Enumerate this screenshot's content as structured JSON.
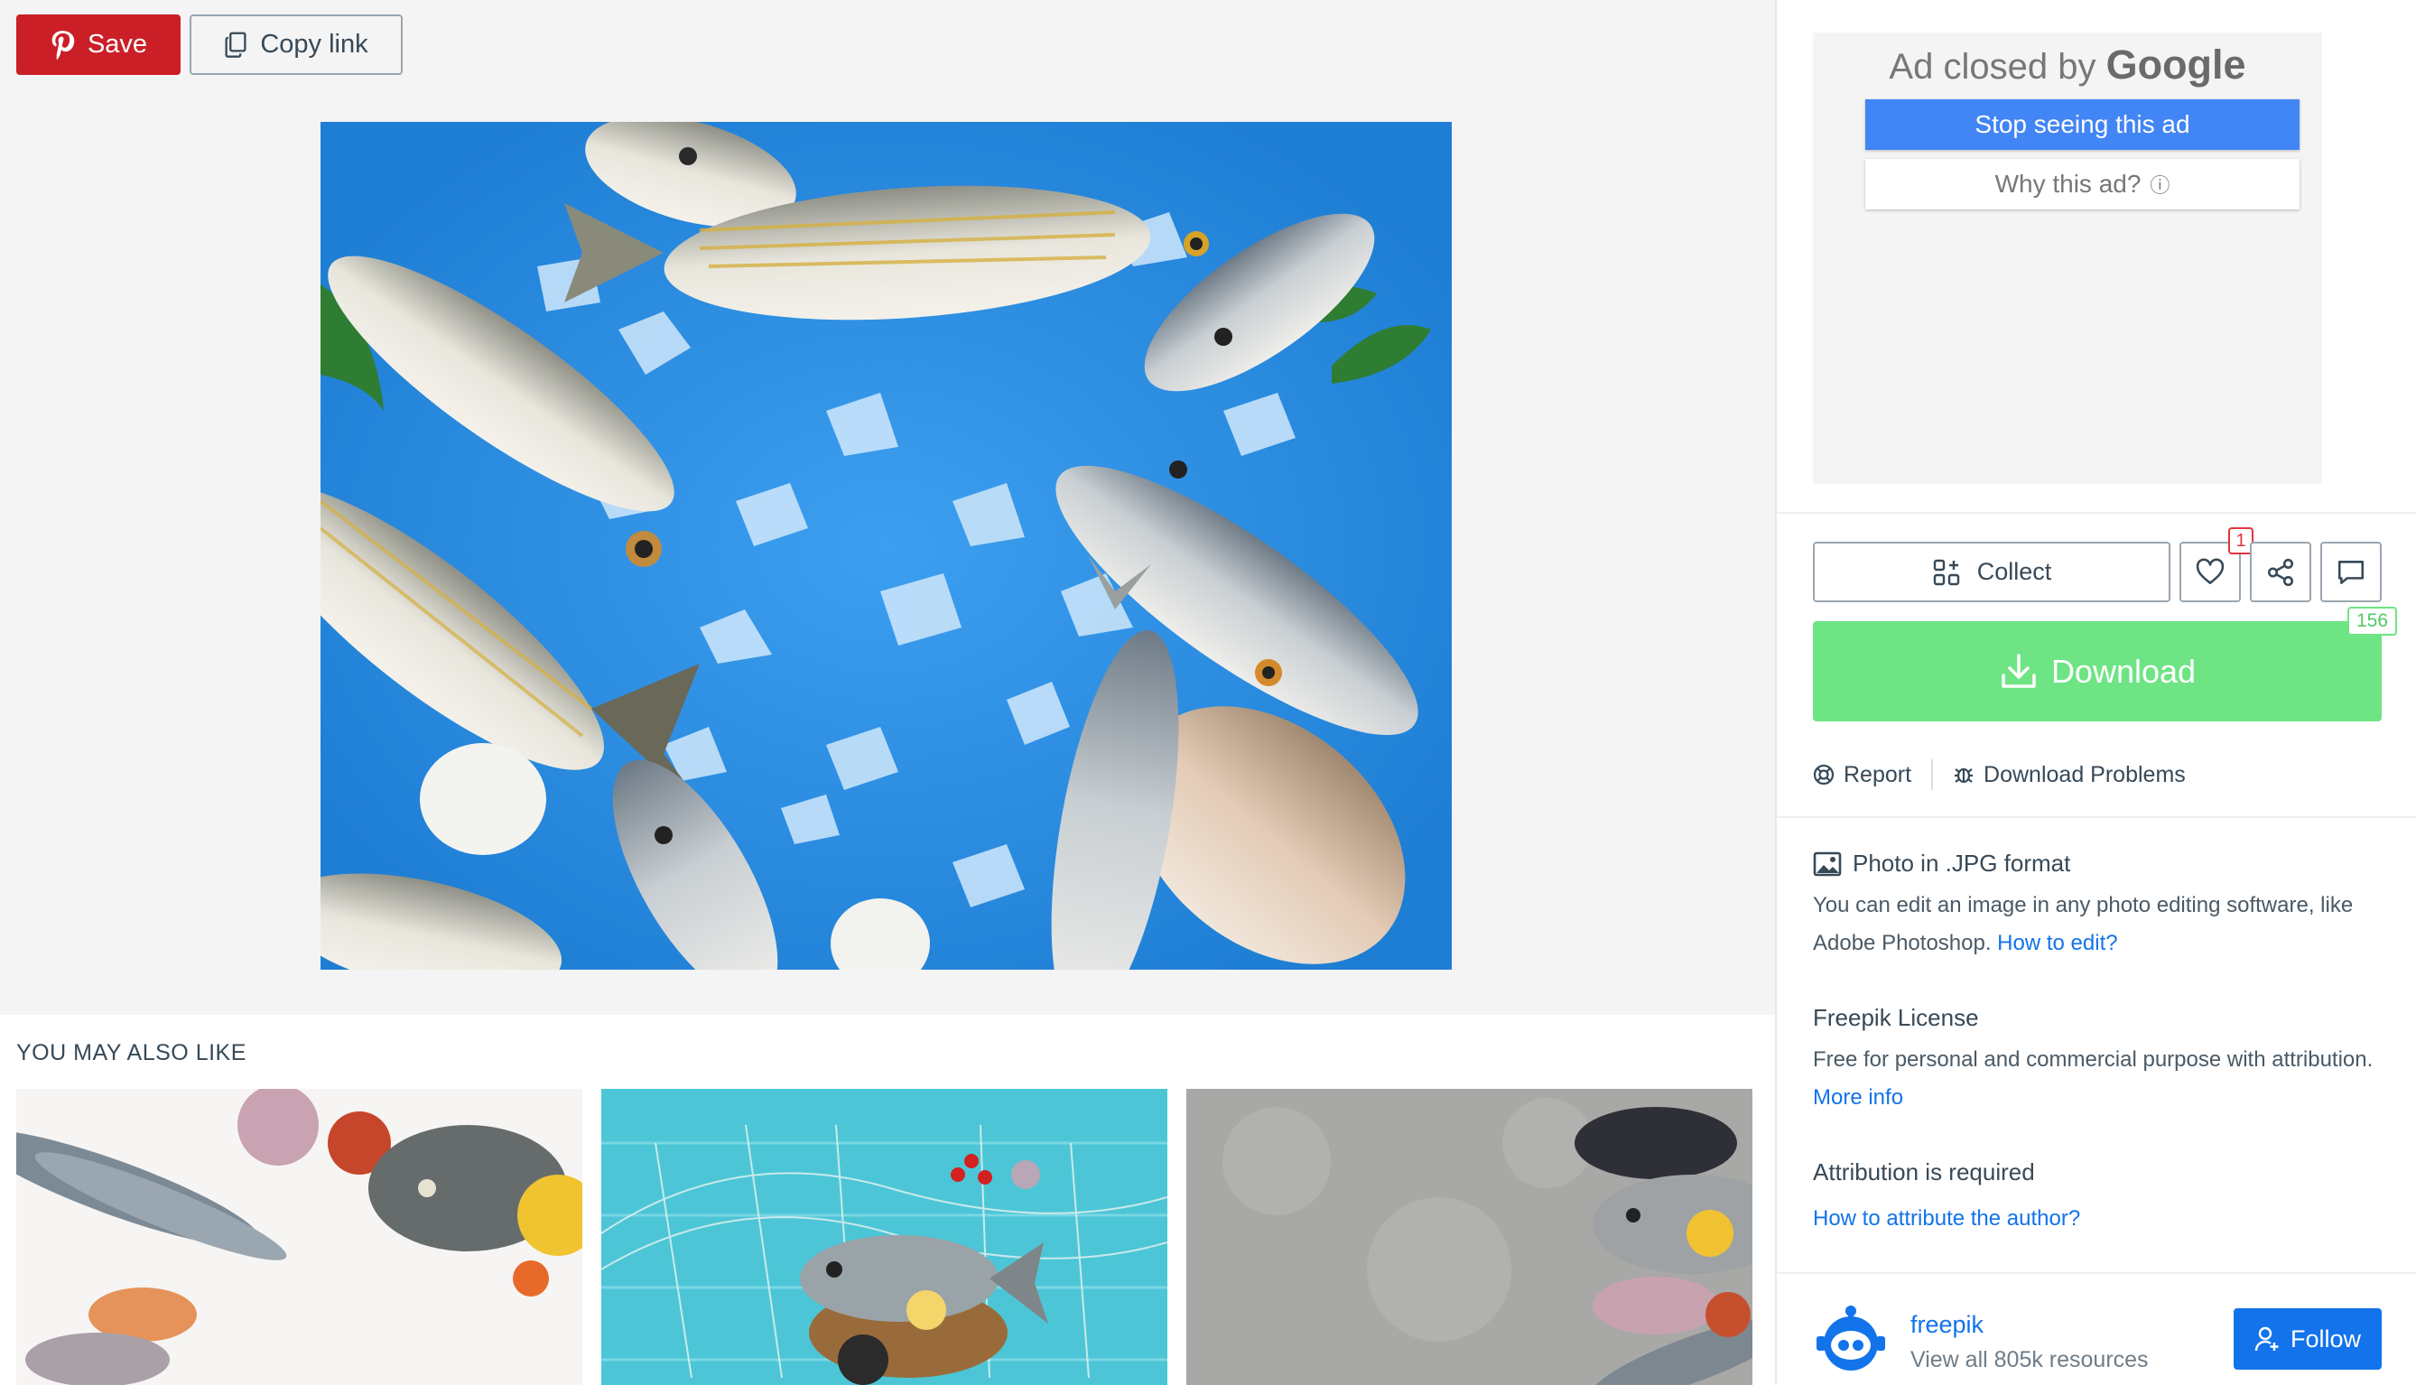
{
  "toolbar": {
    "save_label": "Save",
    "copy_label": "Copy link"
  },
  "related": {
    "title": "YOU MAY ALSO LIKE"
  },
  "ad": {
    "closed_prefix": "Ad closed by",
    "closed_brand": "Google",
    "stop_label": "Stop seeing this ad",
    "why_label": "Why this ad?",
    "why_icon": "ⓘ"
  },
  "actions": {
    "collect_label": "Collect",
    "like_count": "1",
    "download_label": "Download",
    "download_count": "156",
    "report_label": "Report",
    "problems_label": "Download Problems"
  },
  "info": {
    "format_title": "Photo in .JPG format",
    "format_text": "You can edit an image in any photo editing software, like Adobe Photoshop.",
    "format_link": "How to edit?",
    "license_title": "Freepik License",
    "license_text": "Free for personal and commercial purpose with attribution.",
    "license_link": "More info",
    "attribution_title": "Attribution is required",
    "attribution_link": "How to attribute the author?"
  },
  "author": {
    "name": "freepik",
    "resources": "View all 805k resources",
    "follow_label": "Follow"
  },
  "colors": {
    "save": "#cb1f27",
    "download": "#6ee484",
    "link": "#1273eb",
    "google_button": "#4285f4"
  }
}
